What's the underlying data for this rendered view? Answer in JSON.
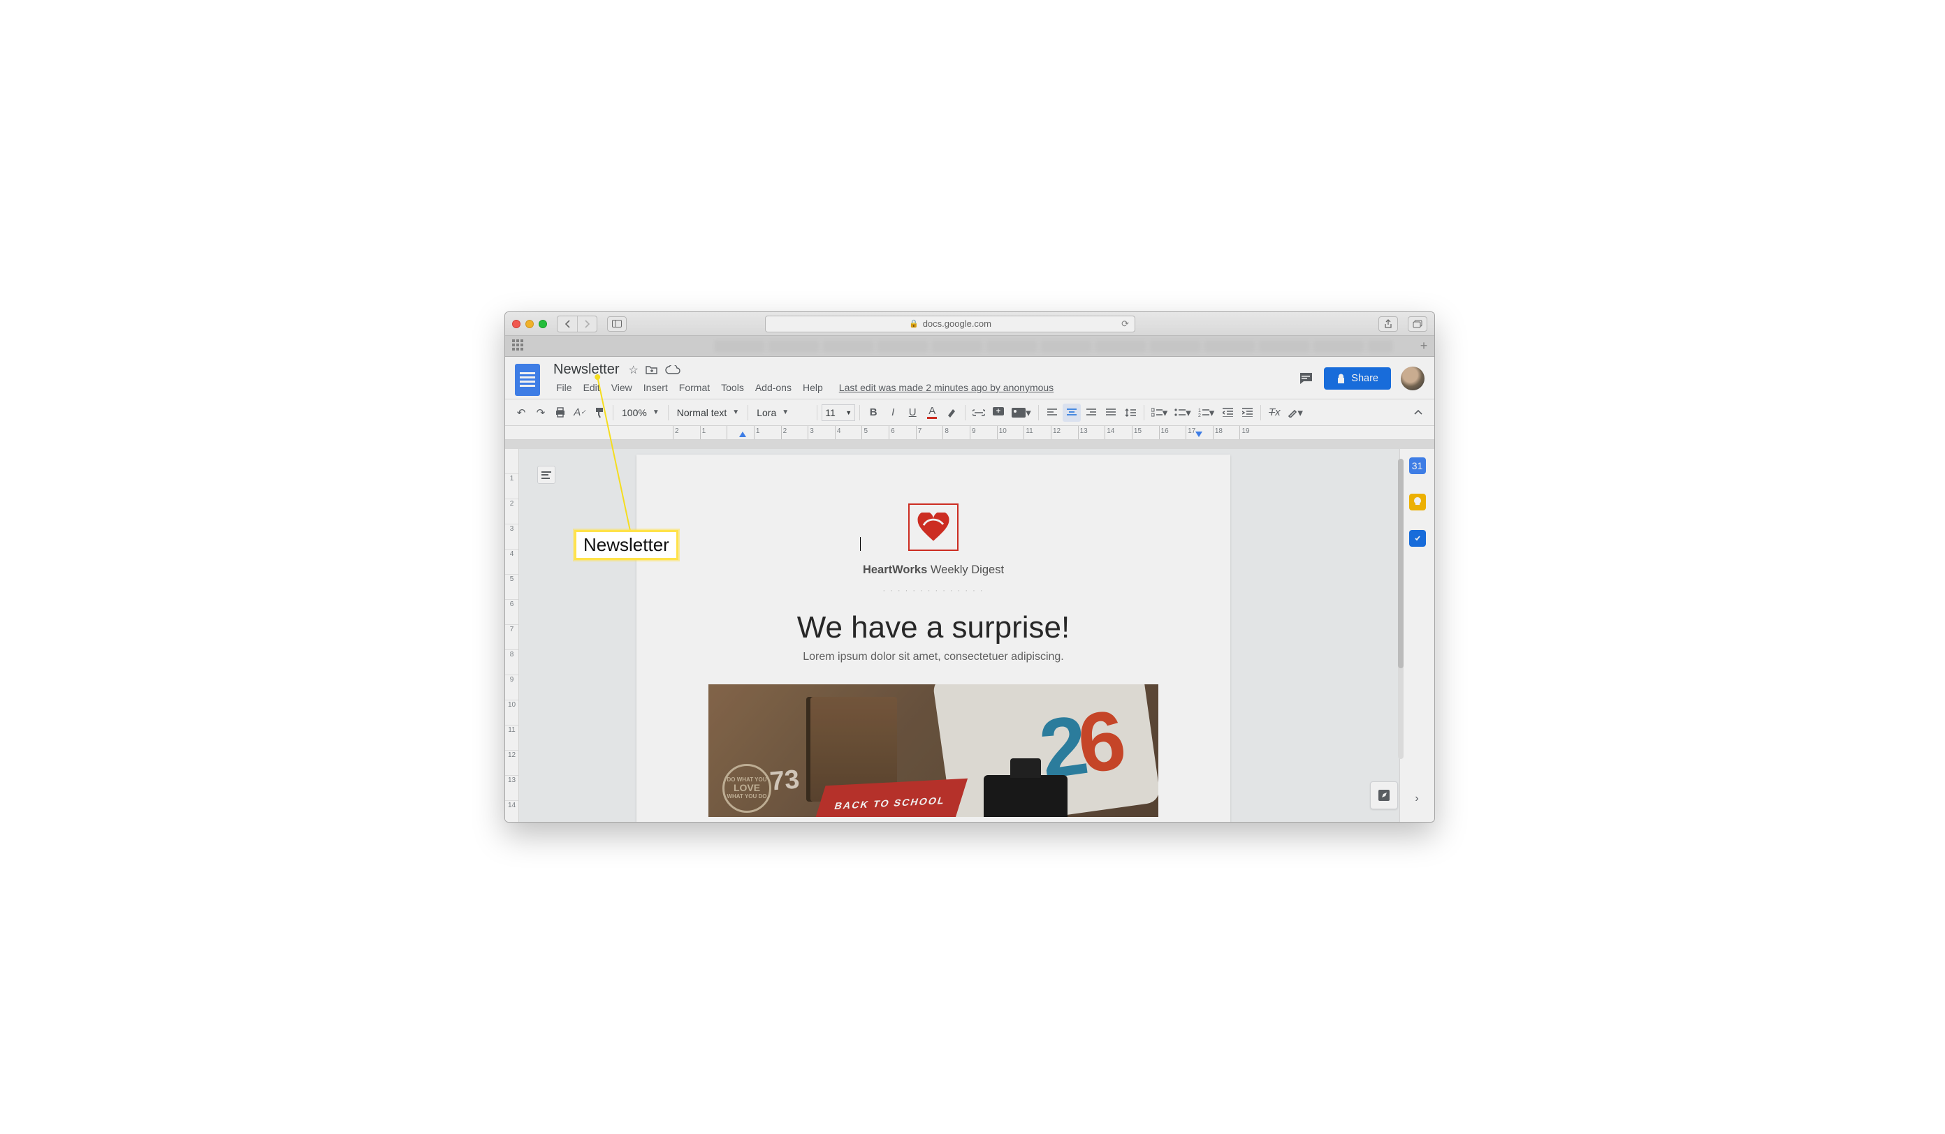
{
  "browser": {
    "url_host": "docs.google.com"
  },
  "doc": {
    "title": "Newsletter",
    "menus": [
      "File",
      "Edit",
      "View",
      "Insert",
      "Format",
      "Tools",
      "Add-ons",
      "Help"
    ],
    "last_edit": "Last edit was made 2 minutes ago by anonymous",
    "share": "Share"
  },
  "toolbar": {
    "zoom": "100%",
    "style": "Normal text",
    "font": "Lora",
    "size": "11"
  },
  "ruler": {
    "h": [
      "2",
      "1",
      "",
      "1",
      "2",
      "3",
      "4",
      "5",
      "6",
      "7",
      "8",
      "9",
      "10",
      "11",
      "12",
      "13",
      "14",
      "15",
      "16",
      "17",
      "18",
      "19"
    ],
    "v": [
      "",
      "1",
      "2",
      "3",
      "4",
      "5",
      "6",
      "7",
      "8",
      "9",
      "10",
      "11",
      "12",
      "13",
      "14"
    ]
  },
  "sidebar": {
    "cal": "31"
  },
  "content": {
    "brand_bold": "HeartWorks",
    "brand_rest": " Weekly Digest",
    "dots": "· · · · · · · · · · · · · ·",
    "headline": "We have a surprise!",
    "sub": "Lorem ipsum dolor sit amet, consectetuer adipiscing.",
    "banner": "BACK TO SCHOOL",
    "digits_blue": "2",
    "digits_red": "6",
    "seventy": "73",
    "stamp_top": "DO WHAT YOU",
    "stamp_mid": "LOVE",
    "stamp_bot": "WHAT YOU DO"
  },
  "callout": "Newsletter"
}
